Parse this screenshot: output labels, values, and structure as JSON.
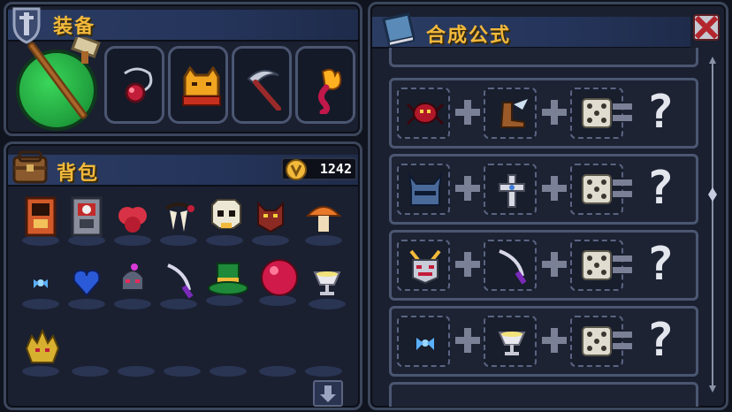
{
  "equipment": {
    "title": "装备",
    "slots": [
      {
        "name": "weapon",
        "icon": "wooden-staff-hammer-icon"
      },
      {
        "name": "amulet",
        "icon": "red-pendant-icon"
      },
      {
        "name": "lucky-cat",
        "icon": "golden-cat-icon"
      },
      {
        "name": "sickle",
        "icon": "scythe-icon"
      },
      {
        "name": "flame",
        "icon": "fire-worm-icon"
      }
    ]
  },
  "backpack": {
    "title": "背包",
    "coins": "1242",
    "items": [
      "arcade-machine-orange-icon",
      "arcade-machine-skull-icon",
      "red-mushroom-cap-icon",
      "fang-claw-icon",
      "skull-icon",
      "wolf-head-icon",
      "orange-mushroom-icon",
      "fairy-icon",
      "blue-heart-icon",
      "helmet-spider-icon",
      "purple-dagger-icon",
      "green-top-hat-icon",
      "red-orb-icon",
      "white-chalice-icon",
      "golden-spiky-head-icon"
    ]
  },
  "recipes": {
    "title": "合成公式",
    "cards": [
      {
        "a": "red-spider-icon",
        "b": "winged-boot-icon",
        "c": "dice-icon",
        "result": "?"
      },
      {
        "a": "horned-knight-helmet-icon",
        "b": "cross-icon",
        "c": "dice-icon",
        "result": "?"
      },
      {
        "a": "oni-mask-icon",
        "b": "purple-dagger-icon",
        "c": "dice-icon",
        "result": "?"
      },
      {
        "a": "fairy-icon",
        "b": "white-chalice-icon",
        "c": "dice-icon",
        "result": "?"
      }
    ]
  },
  "colors": {
    "title_gold": "#f2b93b",
    "panel_bg": "#1a2030",
    "border": "#4b5672",
    "close_red": "#b3262d"
  }
}
